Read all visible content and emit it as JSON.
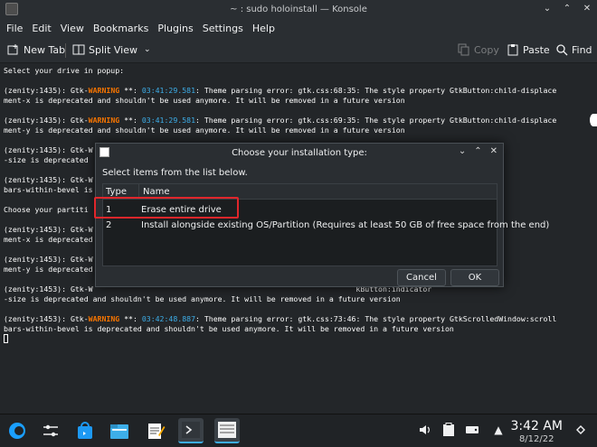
{
  "window": {
    "title": "~ : sudo holoinstall — Konsole"
  },
  "menu": [
    "File",
    "Edit",
    "View",
    "Bookmarks",
    "Plugins",
    "Settings",
    "Help"
  ],
  "toolbar": {
    "new_tab": "New Tab",
    "split_view": "Split View",
    "copy": "Copy",
    "paste": "Paste",
    "find": "Find"
  },
  "terminal": {
    "lines": [
      {
        "plain": "Select your drive in popup:"
      },
      {
        "plain": ""
      },
      {
        "pre": "(zenity:1435): Gtk-",
        "warn": "WARNING",
        "mid": " **: ",
        "time": "03:41:29.581",
        "post": ": Theme parsing error: gtk.css:68:35: The style property GtkButton:child-displace"
      },
      {
        "plain": "ment-x is deprecated and shouldn't be used anymore. It will be removed in a future version"
      },
      {
        "plain": ""
      },
      {
        "pre": "(zenity:1435): Gtk-",
        "warn": "WARNING",
        "mid": " **: ",
        "time": "03:41:29.581",
        "post": ": Theme parsing error: gtk.css:69:35: The style property GtkButton:child-displace"
      },
      {
        "plain": "ment-y is deprecated and shouldn't be used anymore. It will be removed in a future version"
      },
      {
        "plain": ""
      },
      {
        "plain": "(zenity:1435): Gtk-W                                                           kButton:indicator"
      },
      {
        "plain": "-size is deprecated"
      },
      {
        "plain": ""
      },
      {
        "plain": "(zenity:1435): Gtk-W                                                           lledWindow:scroll"
      },
      {
        "plain": "bars-within-bevel is"
      },
      {
        "plain": ""
      },
      {
        "plain": "Choose your partiti"
      },
      {
        "plain": ""
      },
      {
        "plain": "(zenity:1453): Gtk-W                                                           :child-displace"
      },
      {
        "plain": "ment-x is deprecated"
      },
      {
        "plain": ""
      },
      {
        "plain": "(zenity:1453): Gtk-W                                                           :child-displace"
      },
      {
        "plain": "ment-y is deprecated"
      },
      {
        "plain": ""
      },
      {
        "plain": "(zenity:1453): Gtk-W                                                           kButton:indicator"
      },
      {
        "plain": "-size is deprecated and shouldn't be used anymore. It will be removed in a future version"
      },
      {
        "plain": ""
      },
      {
        "pre": "(zenity:1453): Gtk-",
        "warn": "WARNING",
        "mid": " **: ",
        "time": "03:42:48.887",
        "post": ": Theme parsing error: gtk.css:73:46: The style property GtkScrolledWindow:scroll"
      },
      {
        "plain": "bars-within-bevel is deprecated and shouldn't be used anymore. It will be removed in a future version"
      }
    ]
  },
  "dialog": {
    "title": "Choose your installation type:",
    "prompt": "Select items from the list below.",
    "columns": [
      "Type",
      "Name"
    ],
    "rows": [
      {
        "type": "1",
        "name": "Erase entire drive"
      },
      {
        "type": "2",
        "name": "Install alongside existing OS/Partition (Requires at least 50 GB of free space from the end)"
      }
    ],
    "cancel": "Cancel",
    "ok": "OK"
  },
  "taskbar": {
    "time": "3:42 AM",
    "date": "8/12/22"
  },
  "colors": {
    "accent": "#3daee9",
    "warning": "#f67400",
    "highlight_box": "#e0262b"
  }
}
